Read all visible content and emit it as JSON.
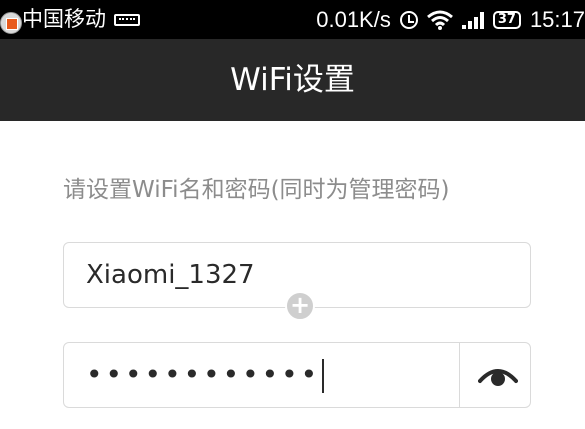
{
  "statusbar": {
    "carrier": "中国移动",
    "speed": "0.01K/s",
    "battery": "37",
    "time": "15:17"
  },
  "titlebar": {
    "title": "WiFi设置"
  },
  "form": {
    "subtitle": "请设置WiFi名和密码(同时为管理密码)",
    "ssid_value": "Xiaomi_1327",
    "password_value": "••••••••••••"
  },
  "icons": {
    "keyboard": "keyboard-icon",
    "alarm": "alarm-icon",
    "wifi": "wifi-icon",
    "signal": "signal-icon",
    "battery": "battery-icon",
    "eye": "eye-icon",
    "plus": "plus-icon"
  },
  "colors": {
    "statusbar_bg": "#000000",
    "titlebar_bg": "#282828",
    "subtitle_text": "#8c8c8c",
    "field_border": "#dadada"
  }
}
